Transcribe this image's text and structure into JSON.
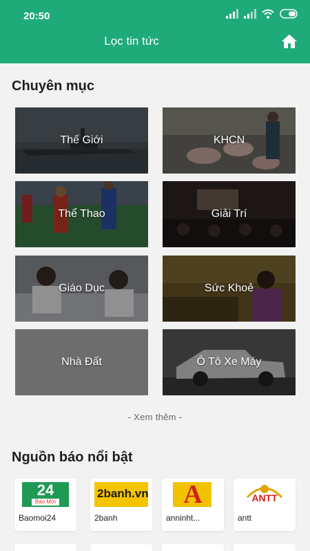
{
  "status": {
    "time": "20:50"
  },
  "header": {
    "title": "Lọc tin tức",
    "home_icon": "home-icon"
  },
  "categories": {
    "title": "Chuyên mục",
    "items": [
      {
        "label": "Thế Giới",
        "image": "warship-photo"
      },
      {
        "label": "KHCN",
        "image": "pig-farm-photo"
      },
      {
        "label": "Thể Thao",
        "image": "football-photo"
      },
      {
        "label": "Giải Trí",
        "image": "auditorium-photo"
      },
      {
        "label": "Giáo Dục",
        "image": "students-photo"
      },
      {
        "label": "Sức Khoẻ",
        "image": "speaker-photo"
      },
      {
        "label": "Nhà Đất",
        "image": "none"
      },
      {
        "label": "Ô Tô Xe Máy",
        "image": "pickup-truck-photo"
      }
    ],
    "more_label": "- Xem thêm -"
  },
  "sources": {
    "title": "Nguồn báo nổi bật",
    "items": [
      {
        "name": "Baomoi24",
        "logo_text": "24",
        "logo_subtext": "Báo Mới"
      },
      {
        "name": "2banh",
        "logo_text": "2banh.vn"
      },
      {
        "name": "anninht...",
        "logo_text": "A"
      },
      {
        "name": "antt",
        "logo_text": "ANTT"
      }
    ]
  },
  "colors": {
    "primary": "#1faa79",
    "background": "#f2f2f2"
  }
}
